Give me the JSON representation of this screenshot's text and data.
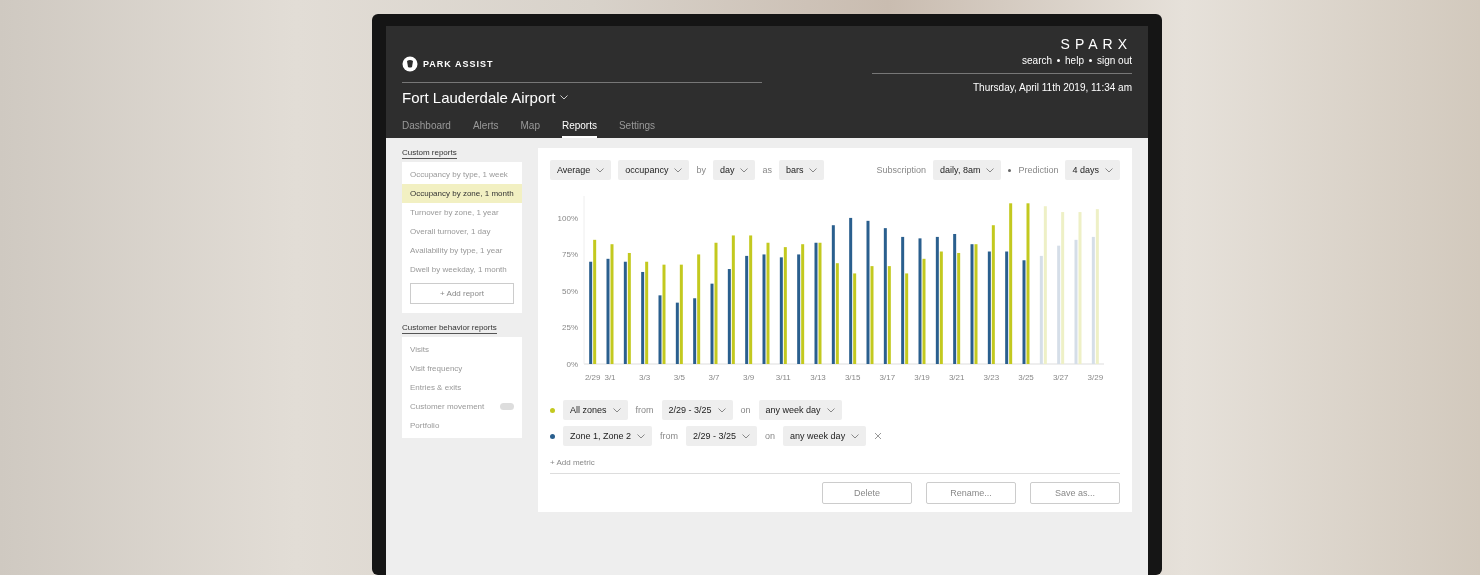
{
  "header": {
    "brand": "PARK ASSIST",
    "product": "SPARX",
    "links": [
      {
        "label": "search"
      },
      {
        "label": "help"
      },
      {
        "label": "sign out"
      }
    ],
    "datetime": "Thursday, April 11th 2019, 11:34 am",
    "location": "Fort Lauderdale Airport"
  },
  "tabs": [
    {
      "label": "Dashboard",
      "selected": false
    },
    {
      "label": "Alerts",
      "selected": false
    },
    {
      "label": "Map",
      "selected": false
    },
    {
      "label": "Reports",
      "selected": true
    },
    {
      "label": "Settings",
      "selected": false
    }
  ],
  "sidebar": {
    "sections": [
      {
        "heading": "Custom reports",
        "items": [
          {
            "label": "Occupancy by type, 1 week",
            "selected": false,
            "badge": false
          },
          {
            "label": "Occupancy by zone, 1 month",
            "selected": true,
            "badge": false
          },
          {
            "label": "Turnover by zone, 1 year",
            "selected": false,
            "badge": false
          },
          {
            "label": "Overall turnover, 1 day",
            "selected": false,
            "badge": false
          },
          {
            "label": "Availability by type, 1 year",
            "selected": false,
            "badge": false
          },
          {
            "label": "Dwell by weekday, 1 month",
            "selected": false,
            "badge": false
          }
        ],
        "add_button": "+ Add report"
      },
      {
        "heading": "Customer behavior reports",
        "items": [
          {
            "label": "Visits",
            "selected": false,
            "badge": false
          },
          {
            "label": "Visit frequency",
            "selected": false,
            "badge": false
          },
          {
            "label": "Entries & exits",
            "selected": false,
            "badge": false
          },
          {
            "label": "Customer movement",
            "selected": false,
            "badge": true
          },
          {
            "label": "Portfolio",
            "selected": false,
            "badge": false
          }
        ]
      }
    ]
  },
  "report": {
    "query": [
      {
        "kind": "dropdown",
        "text": "Average"
      },
      {
        "kind": "dropdown",
        "text": "occupancy"
      },
      {
        "kind": "word",
        "text": "by"
      },
      {
        "kind": "dropdown",
        "text": "day"
      },
      {
        "kind": "word",
        "text": "as"
      },
      {
        "kind": "dropdown",
        "text": "bars"
      }
    ],
    "subscription": {
      "label": "Subscription",
      "value": "daily, 8am"
    },
    "prediction": {
      "label": "Prediction",
      "value": "4 days"
    },
    "chart_data": {
      "type": "bar",
      "categories": [
        "2/29",
        "3/1",
        null,
        "3/3",
        null,
        "3/5",
        null,
        "3/7",
        null,
        "3/9",
        null,
        "3/11",
        null,
        "3/13",
        null,
        "3/15",
        null,
        "3/17",
        null,
        "3/19",
        null,
        "3/21",
        null,
        "3/23",
        null,
        "3/25",
        null,
        "3/27",
        null,
        "3/29"
      ],
      "series": [
        {
          "name": "All zones",
          "color": "#c3c91f",
          "values": [
            85,
            82,
            76,
            70,
            68,
            68,
            75,
            83,
            88,
            88,
            83,
            80,
            82,
            83,
            69,
            62,
            67,
            67,
            62,
            72,
            77,
            76,
            82,
            95,
            110,
            110,
            null,
            null,
            null,
            null
          ]
        },
        {
          "name": "Zone 1, Zone 2",
          "color": "#2a5f8e",
          "values": [
            70,
            72,
            70,
            63,
            47,
            42,
            45,
            55,
            65,
            74,
            75,
            73,
            75,
            83,
            95,
            100,
            98,
            93,
            87,
            86,
            87,
            89,
            82,
            77,
            77,
            71,
            null,
            null,
            null,
            null
          ]
        },
        {
          "color": "#eef0c6",
          "values": [
            null,
            null,
            null,
            null,
            null,
            null,
            null,
            null,
            null,
            null,
            null,
            null,
            null,
            null,
            null,
            null,
            null,
            null,
            null,
            null,
            null,
            null,
            null,
            null,
            null,
            null,
            108,
            104,
            104,
            106
          ]
        },
        {
          "color": "#d5dee8",
          "values": [
            null,
            null,
            null,
            null,
            null,
            null,
            null,
            null,
            null,
            null,
            null,
            null,
            null,
            null,
            null,
            null,
            null,
            null,
            null,
            null,
            null,
            null,
            null,
            null,
            null,
            null,
            74,
            81,
            85,
            87
          ]
        }
      ],
      "ylim": [
        0,
        115
      ],
      "yticks": [
        {
          "value": 0,
          "label": "0%"
        },
        {
          "value": 25,
          "label": "25%"
        },
        {
          "value": 50,
          "label": "50%"
        },
        {
          "value": 75,
          "label": "75%"
        },
        {
          "value": 100,
          "label": "100%"
        }
      ]
    },
    "metrics": [
      {
        "from_label": "from",
        "range": "2/29 - 3/25",
        "on_label": "on",
        "days": "any week day",
        "removable": false
      },
      {
        "from_label": "from",
        "range": "2/29 - 3/25",
        "on_label": "on",
        "days": "any week day",
        "removable": true
      }
    ],
    "add_metric": "+ Add metric",
    "buttons": [
      "Delete",
      "Rename...",
      "Save as..."
    ]
  }
}
